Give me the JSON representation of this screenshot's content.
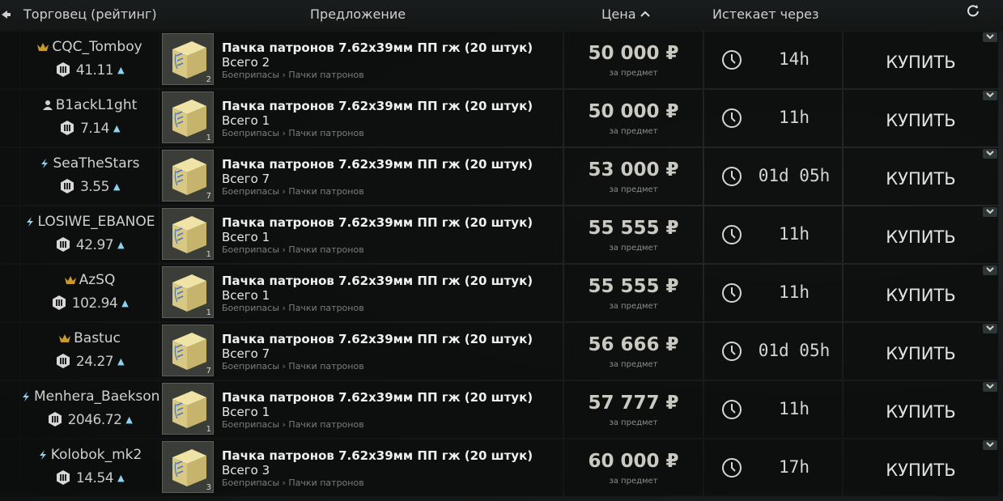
{
  "header": {
    "trader": "Торговец (рейтинг)",
    "offer": "Предложение",
    "price": "Цена",
    "expires": "Истекает через"
  },
  "colors": {
    "accent_blue": "#8fd3ef",
    "crown_gold": "#c89a2c"
  },
  "rows": [
    {
      "trader": "CQC_Tomboy",
      "badge": "crown-icon",
      "rating": "41.11",
      "item": "Пачка патронов 7.62x39мм ПП гж (20 штук)",
      "total": "Всего 2",
      "category": "Боеприпасы › Пачки патронов",
      "count": "2",
      "price": "50 000 ₽",
      "per_item": "за предмет",
      "expires": "14h",
      "buy": "КУПИТЬ"
    },
    {
      "trader": "B1ackL1ght",
      "badge": "user-icon",
      "rating": "7.14",
      "item": "Пачка патронов 7.62x39мм ПП гж (20 штук)",
      "total": "Всего 1",
      "category": "Боеприпасы › Пачки патронов",
      "count": "1",
      "price": "50 000 ₽",
      "per_item": "за предмет",
      "expires": "11h",
      "buy": "КУПИТЬ"
    },
    {
      "trader": "SeaTheStars",
      "badge": "lightning-icon",
      "rating": "3.55",
      "item": "Пачка патронов 7.62x39мм ПП гж (20 штук)",
      "total": "Всего 7",
      "category": "Боеприпасы › Пачки патронов",
      "count": "7",
      "price": "53 000 ₽",
      "per_item": "за предмет",
      "expires": "01d 05h",
      "buy": "КУПИТЬ"
    },
    {
      "trader": "LOSIWE_EBANOE",
      "badge": "lightning-icon",
      "rating": "42.97",
      "item": "Пачка патронов 7.62x39мм ПП гж (20 штук)",
      "total": "Всего 1",
      "category": "Боеприпасы › Пачки патронов",
      "count": "1",
      "price": "55 555 ₽",
      "per_item": "за предмет",
      "expires": "11h",
      "buy": "КУПИТЬ"
    },
    {
      "trader": "AzSQ",
      "badge": "crown-icon",
      "rating": "102.94",
      "item": "Пачка патронов 7.62x39мм ПП гж (20 штук)",
      "total": "Всего 1",
      "category": "Боеприпасы › Пачки патронов",
      "count": "1",
      "price": "55 555 ₽",
      "per_item": "за предмет",
      "expires": "11h",
      "buy": "КУПИТЬ"
    },
    {
      "trader": "Bastuc",
      "badge": "crown-icon",
      "rating": "24.27",
      "item": "Пачка патронов 7.62x39мм ПП гж (20 штук)",
      "total": "Всего 7",
      "category": "Боеприпасы › Пачки патронов",
      "count": "7",
      "price": "56 666 ₽",
      "per_item": "за предмет",
      "expires": "01d 05h",
      "buy": "КУПИТЬ"
    },
    {
      "trader": "Menhera_Baekson",
      "badge": "lightning-icon",
      "rating": "2046.72",
      "item": "Пачка патронов 7.62x39мм ПП гж (20 штук)",
      "total": "Всего 1",
      "category": "Боеприпасы › Пачки патронов",
      "count": "1",
      "price": "57 777 ₽",
      "per_item": "за предмет",
      "expires": "11h",
      "buy": "КУПИТЬ"
    },
    {
      "trader": "Kolobok_mk2",
      "badge": "lightning-icon",
      "rating": "14.54",
      "item": "Пачка патронов 7.62x39мм ПП гж (20 штук)",
      "total": "Всего 3",
      "category": "Боеприпасы › Пачки патронов",
      "count": "3",
      "price": "60 000 ₽",
      "per_item": "за предмет",
      "expires": "17h",
      "buy": "КУПИТЬ"
    }
  ]
}
